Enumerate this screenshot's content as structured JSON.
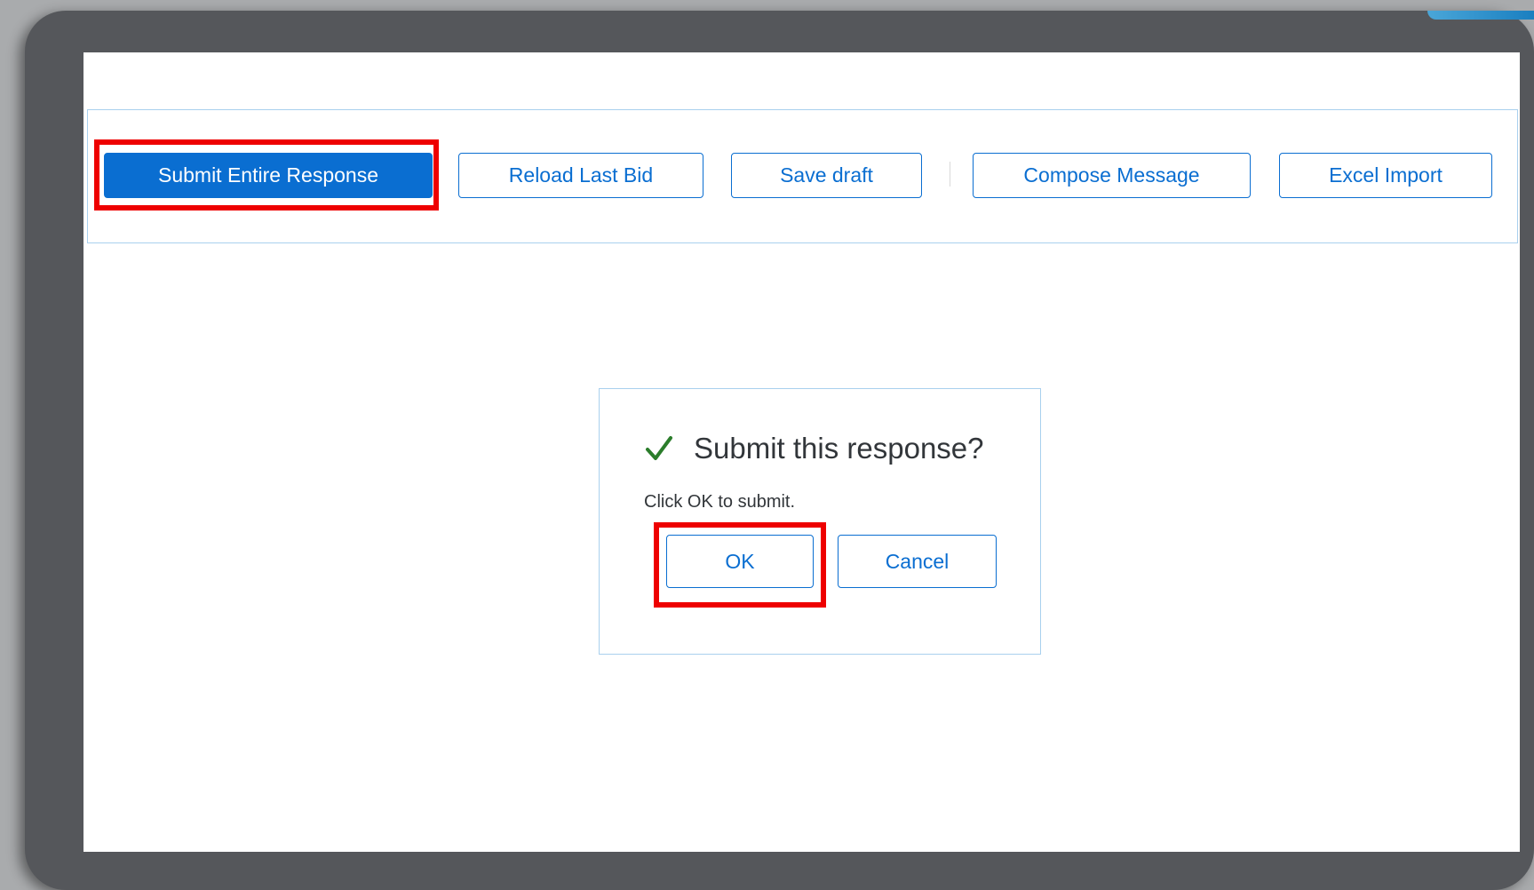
{
  "toolbar": {
    "submit_label": "Submit Entire Response",
    "reload_label": "Reload Last Bid",
    "save_draft_label": "Save draft",
    "compose_label": "Compose Message",
    "excel_import_label": "Excel Import"
  },
  "dialog": {
    "icon": "checkmark-icon",
    "title": "Submit this response?",
    "message": "Click OK to submit.",
    "ok_label": "OK",
    "cancel_label": "Cancel"
  },
  "colors": {
    "accent": "#0a6ed1",
    "highlight": "#ee0000",
    "success": "#2b7d2b",
    "frame": "#55575b"
  }
}
